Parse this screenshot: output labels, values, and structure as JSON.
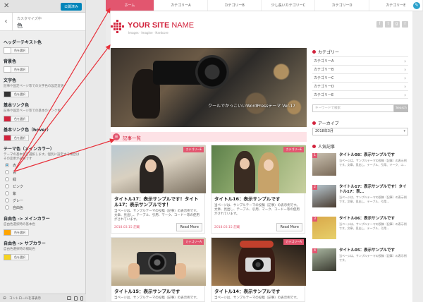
{
  "panel": {
    "publish_label": "公開済み",
    "subtitle": "カスタマイズ中",
    "section_title": "色",
    "controls": [
      {
        "title": "ヘッダーテキスト色",
        "desc": "",
        "color": "#ffffff",
        "button": "色を選択"
      },
      {
        "title": "背景色",
        "desc": "",
        "color": "#ffffff",
        "button": "色を選択"
      },
      {
        "title": "文字色",
        "desc": "記事や固定ページ等での文字色の設定変更",
        "color": "#333333",
        "button": "色を選択"
      },
      {
        "title": "基本リンク色",
        "desc": "記事や固定ページ等での基本のリンク色",
        "color": "#d2233c",
        "button": "色を選択"
      },
      {
        "title": "基本リンク色（hover）",
        "desc": "",
        "color": "#d2233c",
        "button": "色を選択"
      }
    ],
    "theme_color": {
      "title": "テーマ色（メインカラー）",
      "desc": "テーマの基本色を選択します。個別に設定する場合はその変更が必要です",
      "options": [
        "赤",
        "青",
        "緑",
        "ピンク",
        "紫",
        "グレー",
        "自由色"
      ],
      "selected": "赤"
    },
    "free_main": {
      "title": "自由色 -> メインカラー",
      "desc": "自由色選択時の基本色",
      "color": "#ffa500",
      "button": "色を選択"
    },
    "free_sub": {
      "title": "自由色 -> サブカラー",
      "desc": "自由色選択時の補助色",
      "color": "#f5d320",
      "button": "色を選択"
    },
    "footer_label": "コントロールを非表示"
  },
  "nav": {
    "items": [
      "ホーム",
      "カテゴリーA",
      "カテゴリーB",
      "少し長いカテゴリーC",
      "カテゴリーD",
      "カテゴリーE"
    ],
    "active_index": 0
  },
  "header": {
    "site_name_bold": "YOUR SITE",
    "site_name_light": " NAME",
    "tagline": "Images · Imagine · Hardcore",
    "social": [
      "f",
      "t",
      "g",
      "r"
    ]
  },
  "hero": {
    "caption": "クールでかっこいいWordPressテーマ Ver.17"
  },
  "list": {
    "heading": "記事一覧",
    "read_more": "Read More",
    "cards": [
      {
        "badge": "カテゴリーE",
        "title": "タイトル17：表示サンプルです！タイトル17：表示サンプルです！",
        "text": "当ページは、サンプルテーマの投稿（記事）の表示例です。文章、見出し、テーブル、引用、マーク、コードー等の使用がされています。",
        "date": "2018.03.15 記載"
      },
      {
        "badge": "カテゴリーE",
        "title": "タイトル16：表示サンプルです",
        "text": "当ページは、サンプルテーマの投稿（記事）の表示例です。文章、見出し、テーブル、引用、マーク、コードー等の使用がされています。",
        "date": "2018.03.15 記載"
      },
      {
        "badge": "カテゴリーA",
        "title": "タイトル15：表示サンプルです",
        "text": "当ページは、サンプルテーマの投稿（記事）の表示例です。",
        "date": ""
      },
      {
        "badge": "カテゴリーA",
        "title": "タイトル14：表示サンプルです",
        "text": "当ページは、サンプルテーマの投稿（記事）の表示例です。",
        "date": ""
      }
    ]
  },
  "sidebar": {
    "category_title": "カテゴリー",
    "categories": [
      "カテゴリーA",
      "カテゴリーB",
      "カテゴリーC",
      "カテゴリーD",
      "カテゴリーE"
    ],
    "search_placeholder": "キーワードで検索",
    "search_button": "Search",
    "archive_title": "アーカイブ",
    "archive_selected": "2018年3月",
    "popular_title": "人気記事",
    "popular": [
      {
        "num": "1",
        "title": "タイトル08：表示サンプルです",
        "text": "当ページは、サンプルテーマの投稿（記事）の表示例です。文章、見出し、テーブル、引用、マーク、コ…"
      },
      {
        "num": "2",
        "title": "タイトル17：表示サンプルです！タイトル17：表…",
        "text": "当ページは、サンプルテーマの投稿（記事）の表示例です。文章、見出し、テーブル、引用…"
      },
      {
        "num": "3",
        "title": "タイトル06：表示サンプルです",
        "text": "当ページは、サンプルテーマの投稿（記事）の表示例です。文章、見出し、テーブル、引用…"
      },
      {
        "num": "4",
        "title": "タイトル05：表示サンプルです",
        "text": "当ページは、サンプルテーマの投稿（記事）の表示例です。"
      }
    ]
  }
}
